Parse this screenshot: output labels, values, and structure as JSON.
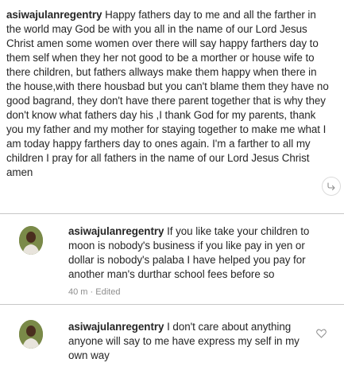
{
  "main_comment": {
    "username": "asiwajulanregentry",
    "text": " Happy fathers day to me and all the farther in the world may God be with you all in the name of our Lord Jesus Christ amen some women over there will say happy farthers day to them self when they her not good to be a morther or house wife to there children, but fathers allways make them happy when there in the house,with there housbad but you can't blame them they have no good bagrand, they don't have there parent together that is why they don't know what fathers day his ,I thank God for my parents, thank you my father and my mother for staying together to make me what I am today happy farthers day to ones again. I'm a farther to all my children I pray for all fathers in the name of our Lord Jesus Christ amen"
  },
  "replies": [
    {
      "username": "asiwajulanregentry",
      "text": " If you like take your children to moon is nobody's business if you like pay in yen or dollar is nobody's palaba I have helped you pay for another man's durthar school fees before so",
      "time": "40 m",
      "separator": "·",
      "edited_label": "Edited"
    },
    {
      "username": "asiwajulanregentry",
      "text": " I don't care about anything anyone will say to me have express my self in my own way"
    }
  ],
  "icons": {
    "reply_indicator": "reply-arrow-icon",
    "like": "heart-icon",
    "avatar": "profile-avatar"
  },
  "colors": {
    "text": "#262626",
    "meta": "#8e8e8e",
    "divider": "#c7c7c7"
  }
}
